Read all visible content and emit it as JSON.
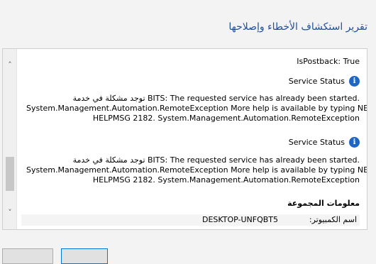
{
  "window": {
    "title": "تقرير استكشاف الأخطاء وإصلاحها"
  },
  "report": {
    "is_postback": "IsPostback: True",
    "entries": [
      {
        "status_label": "Service Status",
        "lines": [
          "توجد مشكلة في خدمة BITS: The requested service has already been started.",
          "System.Management.Automation.RemoteException More help is available by typing NET",
          "HELPMSG 2182. System.Management.Automation.RemoteException"
        ]
      },
      {
        "status_label": "Service Status",
        "lines": [
          "توجد مشكلة في خدمة BITS: The requested service has already been started.",
          "System.Management.Automation.RemoteException More help is available by typing NET",
          "HELPMSG 2182. System.Management.Automation.RemoteException"
        ]
      }
    ],
    "group_info": {
      "heading": "معلومات المجموعة",
      "computer_label": "اسم الكمبيوتر:",
      "computer_value": "DESKTOP-UNFQBT5"
    }
  },
  "icons": {
    "scroll_up": "chevron-up-icon",
    "scroll_down": "chevron-down-icon",
    "info": "info-icon"
  },
  "colors": {
    "title": "#1f4e9c",
    "info_icon": "#1f66c4"
  }
}
